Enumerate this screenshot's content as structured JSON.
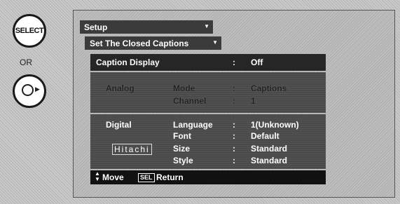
{
  "remote": {
    "select_label": "SELECT",
    "or_label": "OR"
  },
  "menu": {
    "title": "Setup",
    "submenu": "Set The Closed Captions",
    "caption_display": {
      "label": "Caption Display",
      "sep": ":",
      "value": "Off"
    },
    "analog": {
      "label": "Analog",
      "rows": [
        {
          "label": "Mode",
          "sep": ":",
          "value": "Captions"
        },
        {
          "label": "Channel",
          "sep": ":",
          "value": "1"
        }
      ]
    },
    "digital": {
      "label": "Digital",
      "logo": "Hitachi",
      "rows": [
        {
          "label": "Language",
          "sep": ":",
          "value": "1(Unknown)"
        },
        {
          "label": "Font",
          "sep": ":",
          "value": "Default"
        },
        {
          "label": "Size",
          "sep": ":",
          "value": "Standard"
        },
        {
          "label": "Style",
          "sep": ":",
          "value": "Standard"
        }
      ]
    },
    "status": {
      "move_label": "Move",
      "sel_key": "SEL",
      "return_label": "Return"
    }
  }
}
